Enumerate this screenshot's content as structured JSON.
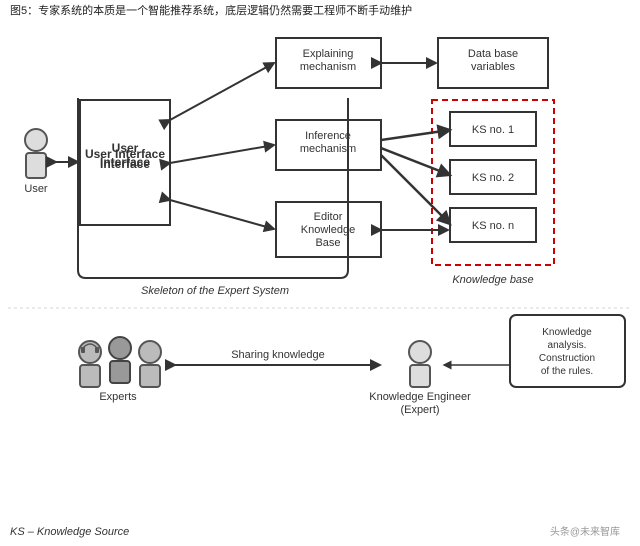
{
  "caption": "图5：专家系统的本质是一个智能推荐系统，底层逻辑仍然需要工程师不断手动维护",
  "diagram": {
    "user_label": "User",
    "ui_box_label": "User Interface",
    "explaining_label": "Explaining mechanism",
    "inference_label": "Inference mechanism",
    "editor_label": "Editor Knowledge Base",
    "db_label": "Data base variables",
    "ks1_label": "KS no. 1",
    "ks2_label": "KS no. 2",
    "ksn_label": "KS no. n",
    "skeleton_label": "Skeleton of the Expert System",
    "kb_label": "Knowledge base",
    "sharing_label": "Sharing knowledge",
    "experts_label": "Experts",
    "ke_label": "Knowledge Engineer (Expert)",
    "ka_label": "Knowledge analysis. Construction of the rules.",
    "ks_footnote": "KS – Knowledge Source"
  },
  "watermark": "头条@未来智库",
  "colors": {
    "border": "#333333",
    "dashed_red": "#cc0000",
    "bg": "#ffffff",
    "arrow": "#333333",
    "figure": "#cccccc"
  }
}
